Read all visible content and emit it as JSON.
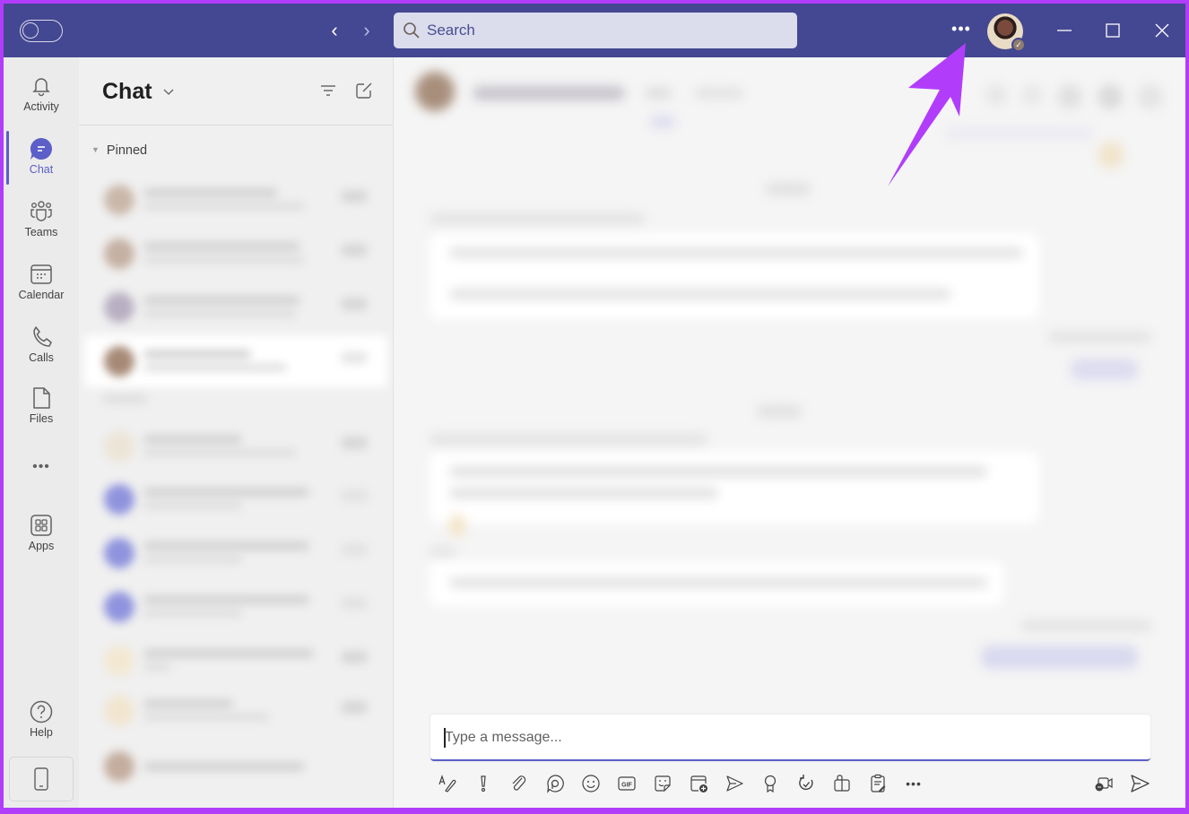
{
  "titlebar": {
    "search_placeholder": "Search",
    "more_label": "•••",
    "back_icon": "‹",
    "forward_icon": "›",
    "user_status": "available-check"
  },
  "rail": {
    "items": [
      {
        "label": "Activity",
        "icon": "bell-icon"
      },
      {
        "label": "Chat",
        "icon": "chat-icon",
        "active": true
      },
      {
        "label": "Teams",
        "icon": "teams-icon"
      },
      {
        "label": "Calendar",
        "icon": "calendar-icon"
      },
      {
        "label": "Calls",
        "icon": "phone-icon"
      },
      {
        "label": "Files",
        "icon": "file-icon"
      },
      {
        "label": "Apps",
        "icon": "apps-icon"
      },
      {
        "label": "Help",
        "icon": "help-icon"
      }
    ],
    "more_label": "•••"
  },
  "chatlist": {
    "title": "Chat",
    "pinned_label": "Pinned",
    "rows_blurred": true
  },
  "main": {
    "compose_placeholder": "Type a message...",
    "toolbar": [
      "format-icon",
      "important-icon",
      "attach-icon",
      "loop-icon",
      "emoji-icon",
      "gif-icon",
      "sticker-icon",
      "schedule-meeting-icon",
      "stream-icon",
      "praise-icon",
      "updates-icon",
      "loop-component-icon",
      "forms-icon",
      "more-options-icon"
    ],
    "gif_label": "GIF",
    "more_label": "•••",
    "content_blurred": true
  },
  "colors": {
    "titlebar": "#444791",
    "accent": "#5b5fc7",
    "annotation": "#b13dfb"
  }
}
